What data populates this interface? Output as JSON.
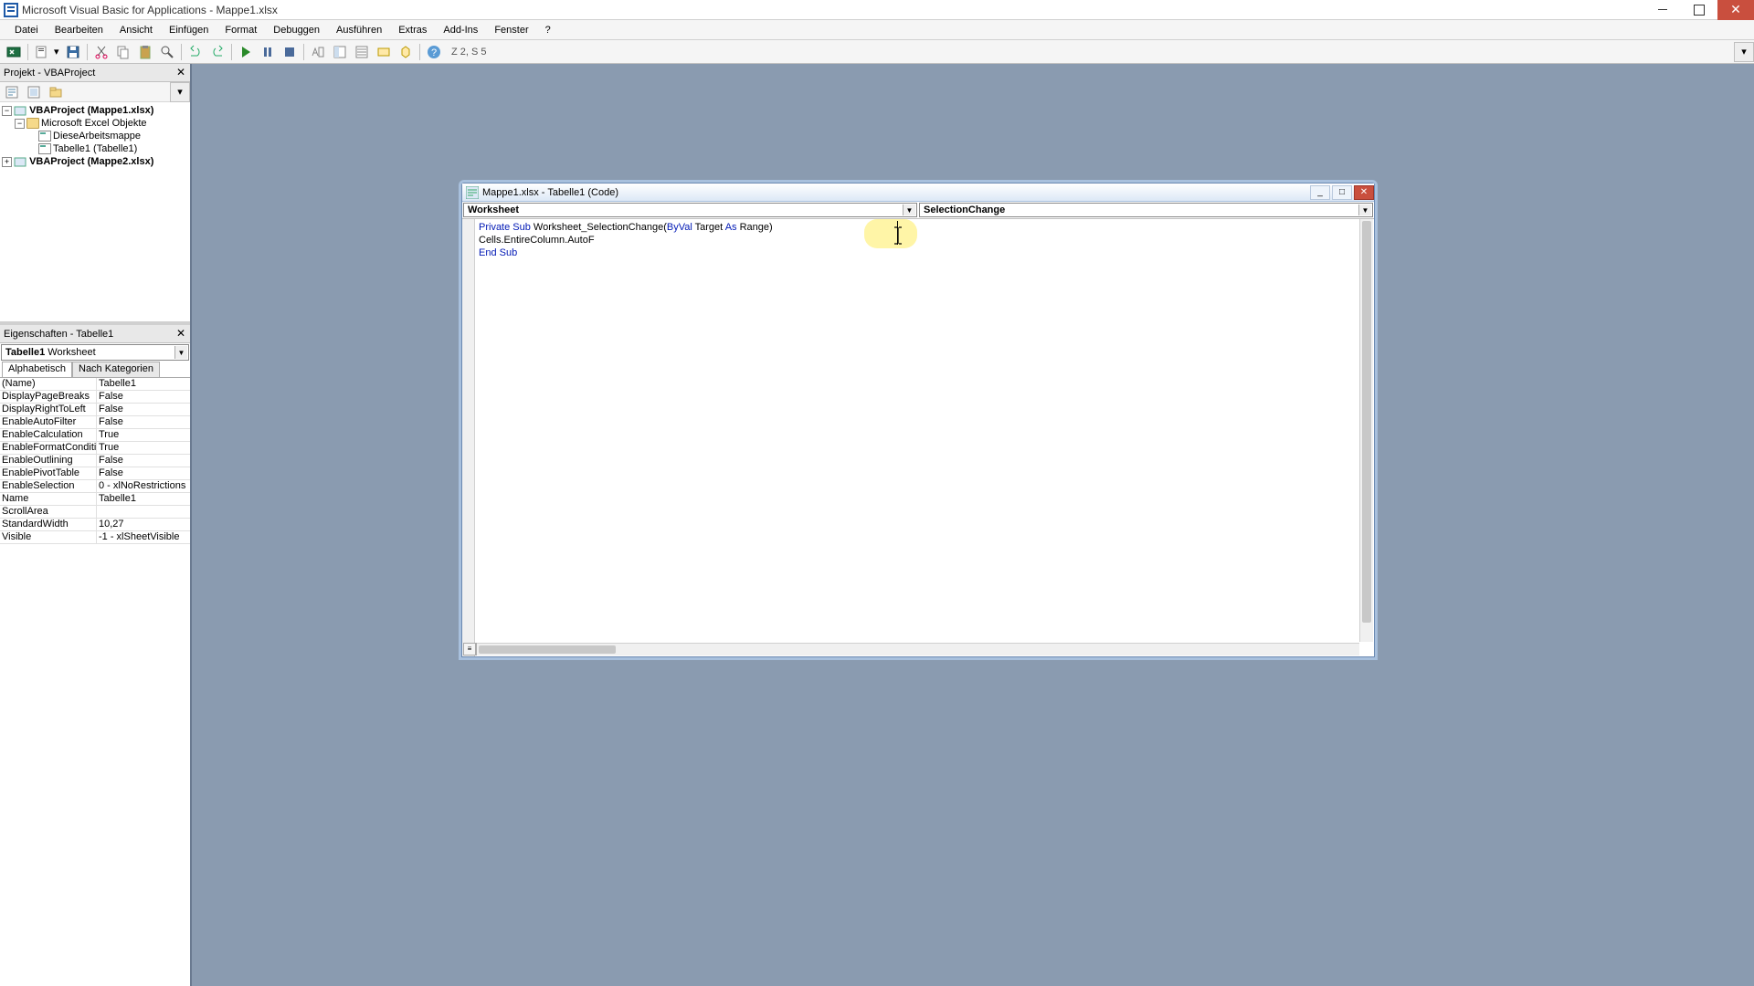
{
  "title": "Microsoft Visual Basic for Applications - Mappe1.xlsx",
  "menu": [
    "Datei",
    "Bearbeiten",
    "Ansicht",
    "Einfügen",
    "Format",
    "Debuggen",
    "Ausführen",
    "Extras",
    "Add-Ins",
    "Fenster",
    "?"
  ],
  "toolbar_label": "Z 2, S 5",
  "panels": {
    "project_title": "Projekt - VBAProject",
    "properties_title": "Eigenschaften - Tabelle1"
  },
  "tree": {
    "proj1": "VBAProject (Mappe1.xlsx)",
    "folder1": "Microsoft Excel Objekte",
    "obj1": "DieseArbeitsmappe",
    "obj2": "Tabelle1 (Tabelle1)",
    "proj2": "VBAProject (Mappe2.xlsx)"
  },
  "prop_combo": {
    "name": "Tabelle1",
    "type": "Worksheet"
  },
  "prop_tabs": [
    "Alphabetisch",
    "Nach Kategorien"
  ],
  "properties": [
    {
      "name": "(Name)",
      "value": "Tabelle1"
    },
    {
      "name": "DisplayPageBreaks",
      "value": "False"
    },
    {
      "name": "DisplayRightToLeft",
      "value": "False"
    },
    {
      "name": "EnableAutoFilter",
      "value": "False"
    },
    {
      "name": "EnableCalculation",
      "value": "True"
    },
    {
      "name": "EnableFormatConditionsCalc",
      "value": "True"
    },
    {
      "name": "EnableOutlining",
      "value": "False"
    },
    {
      "name": "EnablePivotTable",
      "value": "False"
    },
    {
      "name": "EnableSelection",
      "value": "0 - xlNoRestrictions"
    },
    {
      "name": "Name",
      "value": "Tabelle1"
    },
    {
      "name": "ScrollArea",
      "value": ""
    },
    {
      "name": "StandardWidth",
      "value": "10,27"
    },
    {
      "name": "Visible",
      "value": "-1 - xlSheetVisible"
    }
  ],
  "code_window": {
    "title": "Mappe1.xlsx - Tabelle1 (Code)",
    "object_combo": "Worksheet",
    "proc_combo": "SelectionChange",
    "code": {
      "l1_kw1": "Private Sub",
      "l1_name": " Worksheet_SelectionChange(",
      "l1_kw2": "ByVal",
      "l1_mid": " Target ",
      "l1_kw3": "As",
      "l1_end": " Range)",
      "l2": "Cells.EntireColumn.AutoF",
      "l3_kw": "End Sub"
    }
  }
}
